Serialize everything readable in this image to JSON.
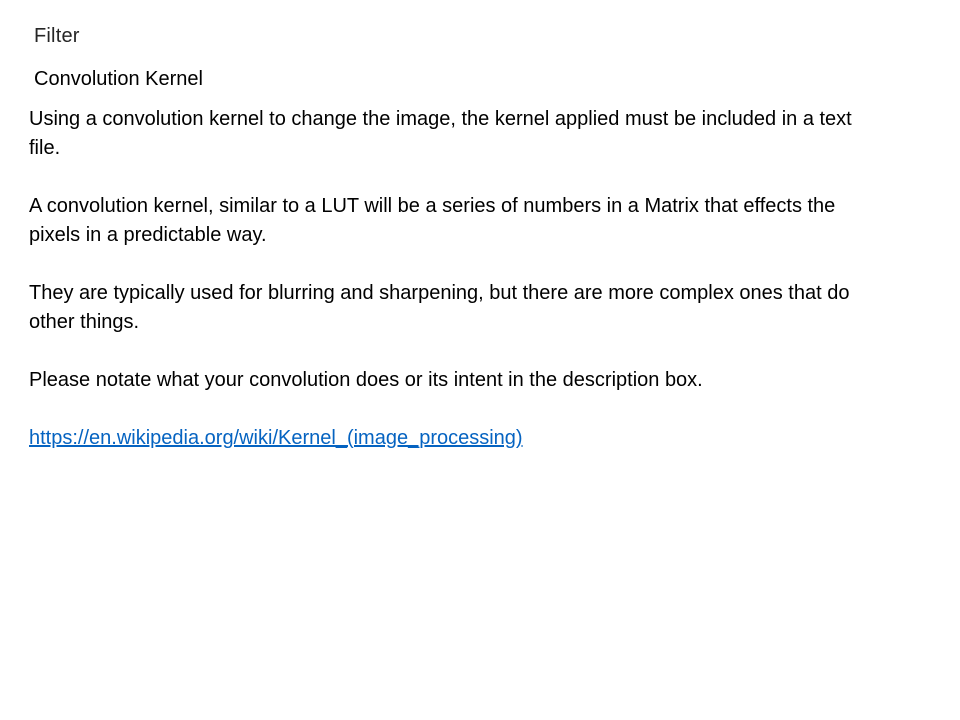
{
  "slide": {
    "section_label": "Filter",
    "heading": "Convolution Kernel",
    "paragraphs": [
      "Using a convolution kernel to change the image, the kernel applied must  be included in a text file.",
      "A convolution kernel, similar to a LUT will be a series of numbers in a Matrix that effects the pixels in a predictable way.",
      "They are typically used for blurring and sharpening, but there are more complex ones that do other things.",
      "Please notate what your convolution does or its intent in the description box."
    ],
    "link": {
      "text": "https://en.wikipedia.org/wiki/Kernel_(image_processing)"
    },
    "link_color": "#0563c1"
  }
}
